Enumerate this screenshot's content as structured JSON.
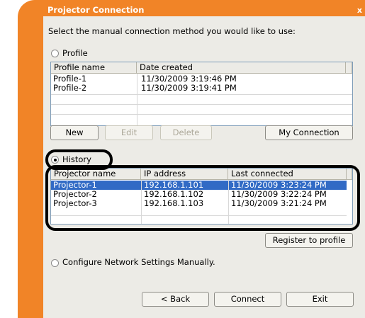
{
  "window": {
    "title": "Projector Connection",
    "close_glyph": "x"
  },
  "instruction": "Select the manual connection method you would like to use:",
  "profile_section": {
    "radio_label": "Profile",
    "columns": [
      "Profile name",
      "Date created"
    ],
    "rows": [
      {
        "name": "Profile-1",
        "date": "11/30/2009 3:19:46 PM"
      },
      {
        "name": "Profile-2",
        "date": "11/30/2009 3:19:41 PM"
      }
    ],
    "buttons": {
      "new": "New",
      "edit": "Edit",
      "delete": "Delete",
      "my_connection": "My Connection"
    }
  },
  "history_section": {
    "radio_label": "History",
    "columns": [
      "Projector name",
      "IP address",
      "Last connected"
    ],
    "rows": [
      {
        "name": "Projector-1",
        "ip": "192.168.1.101",
        "last": "11/30/2009 3:23:24 PM",
        "selected": true
      },
      {
        "name": "Projector-2",
        "ip": "192.168.1.102",
        "last": "11/30/2009 3:22:24 PM",
        "selected": false
      },
      {
        "name": "Projector-3",
        "ip": "192.168.1.103",
        "last": "11/30/2009 3:21:24 PM",
        "selected": false
      }
    ],
    "register_button": "Register to profile"
  },
  "manual_section": {
    "radio_label": "Configure Network Settings Manually."
  },
  "footer": {
    "back": "< Back",
    "connect": "Connect",
    "exit": "Exit"
  },
  "colors": {
    "accent": "#f18427",
    "selection": "#316ac5",
    "dialog_bg": "#ecebe6"
  }
}
